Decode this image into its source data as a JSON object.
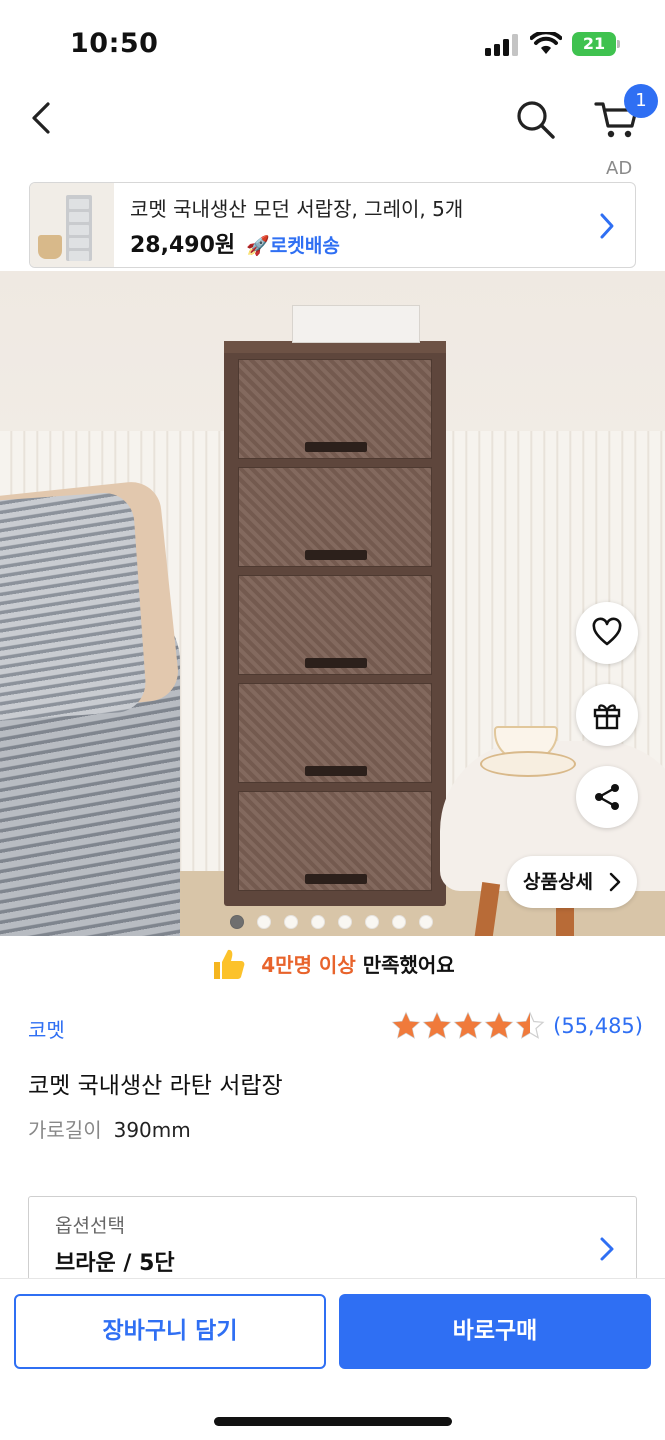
{
  "status_bar": {
    "time": "10:50",
    "battery": "21"
  },
  "nav": {
    "cart_count": "1",
    "back_icon": "chevron-left-icon",
    "search_icon": "search-icon",
    "cart_icon": "cart-icon"
  },
  "ad": {
    "label": "AD",
    "title": "코멧 국내생산 모던 서랍장, 그레이, 5개",
    "price": "28,490원",
    "delivery": "로켓배송"
  },
  "hero": {
    "detail_button": "상품상세",
    "carousel_count": 8,
    "carousel_active": 0,
    "actions": [
      "heart-icon",
      "gift-icon",
      "share-icon"
    ]
  },
  "satisfaction": {
    "highlight": "4만명 이상",
    "rest": " 만족했어요"
  },
  "product": {
    "brand": "코멧",
    "rating": 4.5,
    "review_count": "(55,485)",
    "title": "코멧 국내생산 라탄 서랍장",
    "spec_key": "가로길이",
    "spec_value": "390mm"
  },
  "option": {
    "label": "옵션선택",
    "value": "브라운 / 5단"
  },
  "bottom": {
    "add_to_cart": "장바구니 담기",
    "buy_now": "바로구매"
  },
  "colors": {
    "accent": "#2f6ff3",
    "highlight": "#e8632b",
    "star": "#f07a3b"
  }
}
